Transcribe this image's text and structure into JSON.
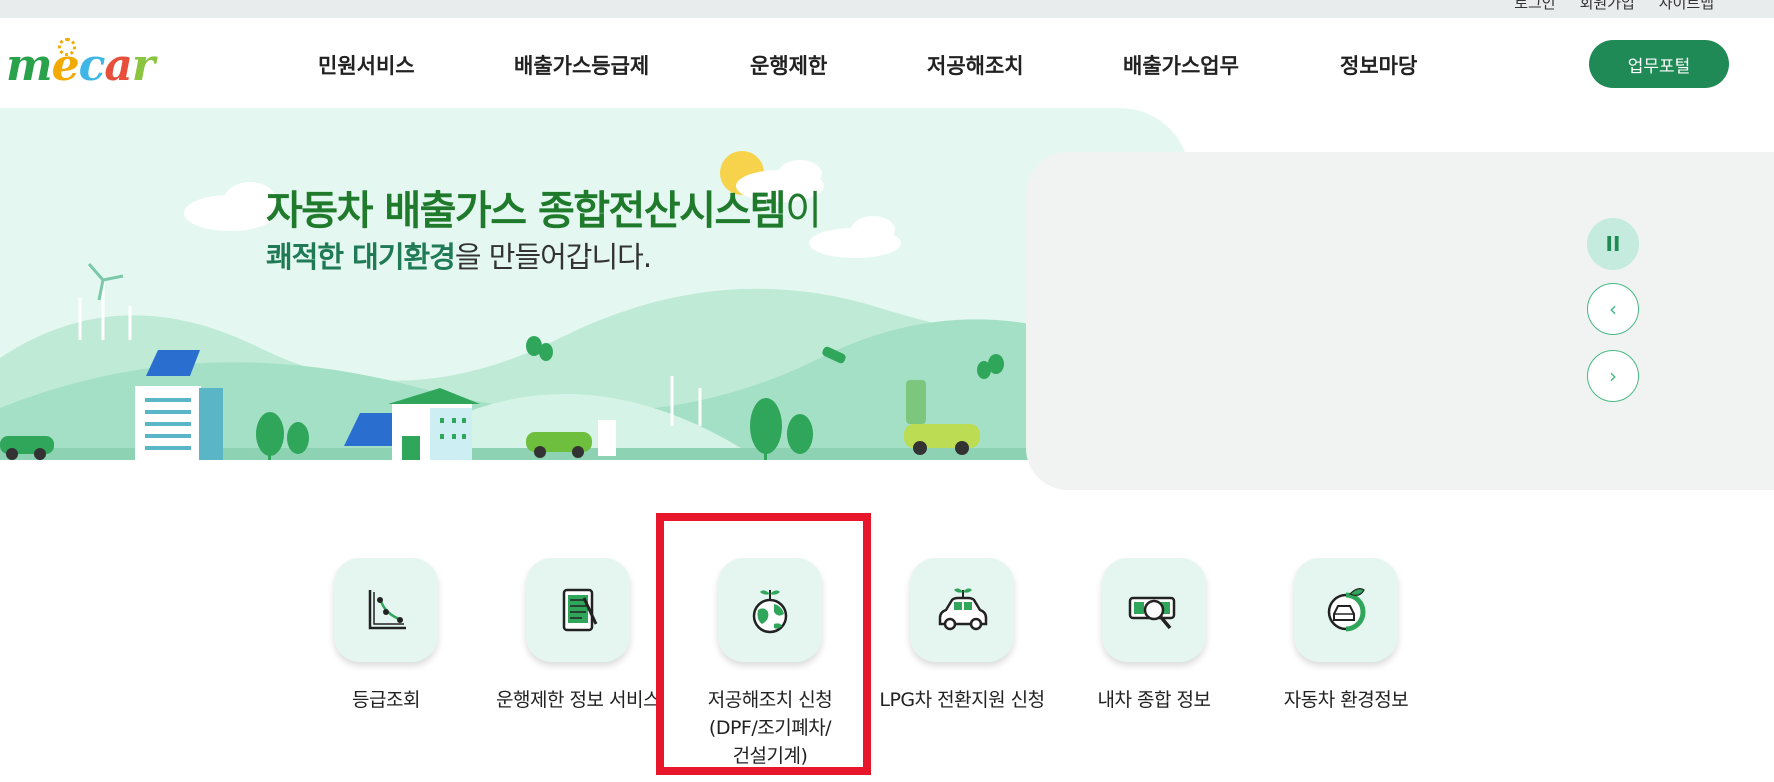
{
  "utility": {
    "links": [
      "로그인",
      "회원가입",
      "사이트맵"
    ]
  },
  "header": {
    "logo_letters": [
      "m",
      "e",
      "c",
      "a",
      "r"
    ],
    "nav": [
      "민원서비스",
      "배출가스등급제",
      "운행제한",
      "저공해조치",
      "배출가스업무",
      "정보마당"
    ],
    "portal_button": "업무포털"
  },
  "hero": {
    "title_bold": "자동차 배출가스 종합전산시스템",
    "title_suffix": "이",
    "sub_bold": "쾌적한 대기환경",
    "sub_rest": "을 만들어갑니다."
  },
  "slider": {
    "pause_label": "II",
    "prev_label": "‹",
    "next_label": "›"
  },
  "quick_menu": [
    {
      "icon": "graph-icon",
      "label": "등급조회"
    },
    {
      "icon": "tablet-document-icon",
      "label": "운행제한 정보 서비스"
    },
    {
      "icon": "earth-sprout-icon",
      "label": "저공해조치 신청\n(DPF/조기폐차/\n건설기계)"
    },
    {
      "icon": "eco-car-icon",
      "label": "LPG차 전환지원 신청"
    },
    {
      "icon": "car-search-icon",
      "label": "내차 종합 정보"
    },
    {
      "icon": "car-leaf-icon",
      "label": "자동차 환경정보"
    }
  ],
  "colors": {
    "brand_green": "#1f8a55",
    "hero_bg": "#e4f8f1",
    "title_green": "#1f7a2c",
    "highlight_red": "#e8162b"
  }
}
